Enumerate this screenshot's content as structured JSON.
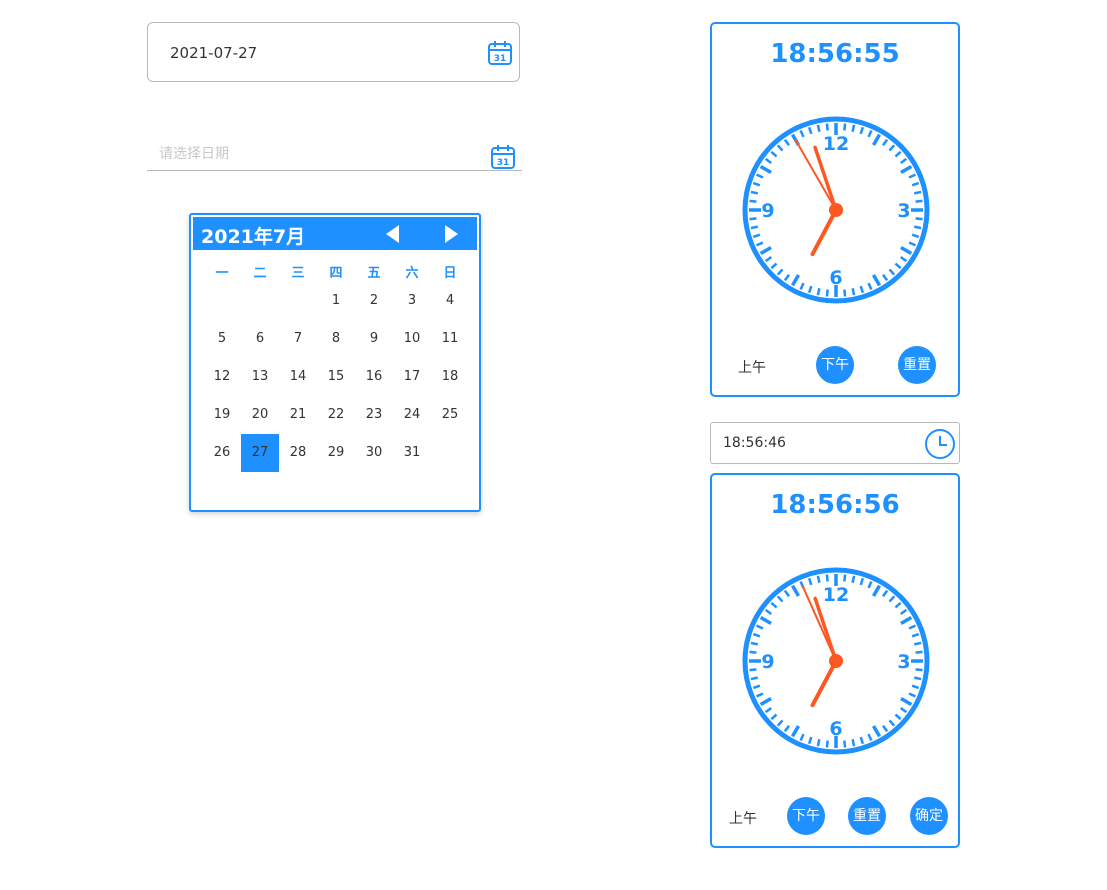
{
  "date_input": {
    "value": "2021-07-27",
    "icon": "calendar-icon",
    "icon_number": "31"
  },
  "date_input_empty": {
    "placeholder": "请选择日期",
    "icon": "calendar-icon",
    "icon_number": "31"
  },
  "calendar": {
    "title": "2021年7月",
    "weekdays": [
      "一",
      "二",
      "三",
      "四",
      "五",
      "六",
      "日"
    ],
    "first_weekday_index": 3,
    "days_in_month": 31,
    "selected_day": 27,
    "accent": "#1e90ff"
  },
  "clock_top": {
    "time": "18:56:55",
    "numerals": [
      "12",
      "3",
      "6",
      "9"
    ],
    "am_label": "上午",
    "pm_label": "下午",
    "reset_label": "重置",
    "hand_color": "#ff5722",
    "face_color": "#1e90ff"
  },
  "time_input": {
    "value": "18:56:46",
    "icon": "clock-icon"
  },
  "clock_bottom": {
    "time": "18:56:56",
    "numerals": [
      "12",
      "3",
      "6",
      "9"
    ],
    "am_label": "上午",
    "pm_label": "下午",
    "reset_label": "重置",
    "confirm_label": "确定",
    "hand_color": "#ff5722",
    "face_color": "#1e90ff"
  }
}
